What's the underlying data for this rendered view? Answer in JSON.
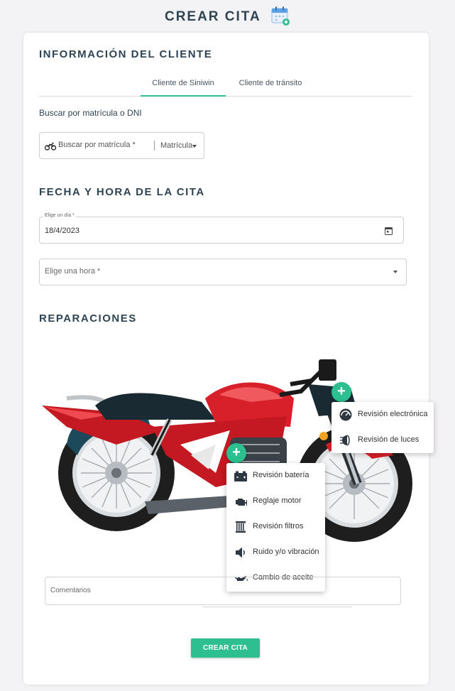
{
  "header": {
    "title": "CREAR CITA",
    "icon": "calendar-add-icon"
  },
  "client_section": {
    "title": "INFORMACIÓN DEL CLIENTE",
    "tabs": [
      {
        "label": "Cliente de Siniwin",
        "active": true
      },
      {
        "label": "Cliente de tránsito",
        "active": false
      }
    ],
    "search_label": "Buscar por matrícula o DNI",
    "search": {
      "placeholder": "Buscar por matrícula *",
      "select_value": "Matrícula",
      "icon": "motorcycle-icon"
    }
  },
  "date_section": {
    "title": "FECHA Y HORA DE LA CITA",
    "date_field": {
      "label": "Elige un día *",
      "value": "18/4/2023",
      "icon": "calendar-icon"
    },
    "time_field": {
      "placeholder": "Elige una hora *"
    }
  },
  "repairs_section": {
    "title": "REPARACIONES",
    "menu_front": [
      {
        "label": "Revisión electrónica",
        "icon": "speedometer-icon"
      },
      {
        "label": "Revisión de luces",
        "icon": "headlight-icon"
      }
    ],
    "menu_engine": [
      {
        "label": "Revisión batería",
        "icon": "battery-icon"
      },
      {
        "label": "Reglaje motor",
        "icon": "engine-icon"
      },
      {
        "label": "Revisión filtros",
        "icon": "filter-icon"
      },
      {
        "label": "Ruido y/o vibración",
        "icon": "speaker-icon"
      },
      {
        "label": "Cambio de aceite",
        "icon": "oil-can-icon"
      }
    ],
    "plus_label": "+"
  },
  "comments": {
    "placeholder": "Comentarios"
  },
  "submit_label": "CREAR CITA",
  "colors": {
    "accent": "#2dbf8f",
    "heading": "#2f4453",
    "moto_red": "#d8202a"
  }
}
